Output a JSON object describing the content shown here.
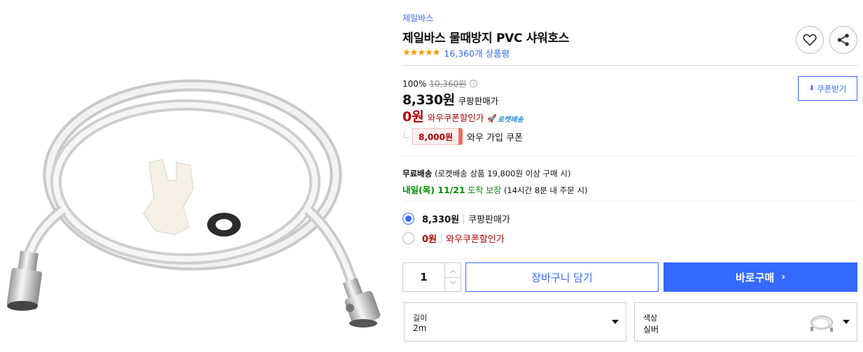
{
  "product": {
    "brand": "제일바스",
    "title": "제일바스 물때방지 PVC 샤워호스",
    "rating_stars": 5,
    "review_count": "16,360개 상품평"
  },
  "icons": {
    "heart": "heart-icon",
    "share": "share-icon",
    "star": "star-icon",
    "info": "info-icon",
    "rocket": "rocket-icon",
    "download": "download-icon",
    "chevron_right": "chevron-right-icon",
    "caret_down": "caret-down-icon"
  },
  "pricing": {
    "discount_rate": "100%",
    "original_price": "10,360원",
    "info_glyph": "i",
    "sale_price": "8,330원",
    "sale_label": "쿠팡판매가",
    "coupon_price": "0원",
    "coupon_label": "와우쿠폰할인가",
    "rocket_label": "로켓배송",
    "wow_coupon_amount": "8,000원",
    "wow_coupon_text": "와우 가입 쿠폰",
    "coupon_button": "쿠폰받기"
  },
  "shipping": {
    "free_label": "무료배송",
    "free_condition": "(로켓배송 상품 19,800원 이상 구매 시)",
    "arrive_day": "내일(목) 11/21",
    "arrive_guarantee": "도착 보장",
    "arrive_condition": "(14시간 8분 내 주문 시)"
  },
  "options": [
    {
      "price": "8,330원",
      "label": "쿠팡판매가",
      "selected": true
    },
    {
      "price": "0원",
      "label": "와우쿠폰할인가",
      "selected": false
    }
  ],
  "purchase": {
    "quantity": "1",
    "cart_button": "장바구니 담기",
    "buy_button": "바로구매",
    "buy_chevron": "›"
  },
  "selects": {
    "length_label": "길이",
    "length_value": "2m",
    "color_label": "색상",
    "color_value": "실버"
  },
  "colors": {
    "accent": "#346aff",
    "red": "#ae0000",
    "green": "#008c00",
    "star": "#ff9600"
  }
}
